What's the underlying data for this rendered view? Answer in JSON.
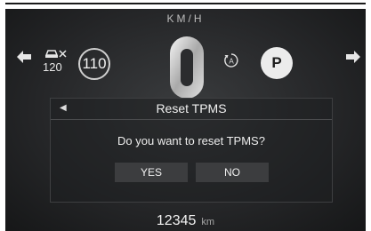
{
  "speed_unit": "KM/H",
  "cruise": {
    "icon": "adaptive-cruise-icon",
    "set_speed": "120"
  },
  "speed_limit": {
    "value": "110"
  },
  "gear": {
    "digit_icon": "zero-digit-icon",
    "auto_icon": "auto-hold-icon",
    "park": "P"
  },
  "dialog": {
    "title": "Reset TPMS",
    "back_icon": "back-arrow-icon",
    "message": "Do you want to reset TPMS?",
    "yes_label": "YES",
    "no_label": "NO"
  },
  "odometer": {
    "value": "12345",
    "unit": "km"
  },
  "colors": {
    "background": "#262729",
    "accent": "#ececec",
    "button": "#3c3d3f"
  }
}
